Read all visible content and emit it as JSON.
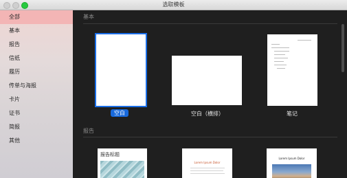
{
  "window": {
    "title": "选取模板"
  },
  "sidebar": {
    "items": [
      {
        "label": "全部",
        "selected": true
      },
      {
        "label": "基本"
      },
      {
        "label": "报告"
      },
      {
        "label": "信纸"
      },
      {
        "label": "履历"
      },
      {
        "label": "传单与海报"
      },
      {
        "label": "卡片"
      },
      {
        "label": "证书"
      },
      {
        "label": "简报"
      },
      {
        "label": "其他"
      }
    ]
  },
  "main": {
    "sections": [
      {
        "title": "基本",
        "templates": [
          {
            "label": "空白",
            "selected": true
          },
          {
            "label": "空白（横排）"
          },
          {
            "label": "笔记"
          }
        ]
      },
      {
        "title": "报告",
        "templates": [
          {
            "thumb_title": "报告标题"
          },
          {
            "thumb_title": "Lorem Ipsum Dolor"
          },
          {
            "thumb_title": "Lorem Ipsum Dolor"
          }
        ]
      }
    ]
  },
  "colors": {
    "accent": "#1769dc",
    "sidebar_selected": "#f3b5b5",
    "content_background": "#1f1f1f"
  }
}
